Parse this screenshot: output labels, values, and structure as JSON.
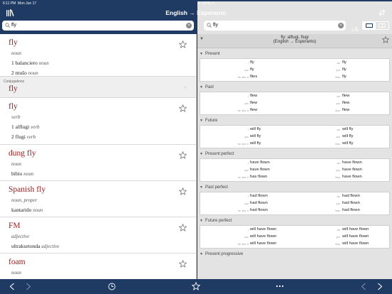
{
  "status": {
    "time": "6:11 PM",
    "date": "Mon Jun 17",
    "battery": "100%"
  },
  "nav": {
    "title": "English → Esperanto"
  },
  "search_left": {
    "value": "fly"
  },
  "search_right": {
    "value": "fly"
  },
  "font_button": {
    "small": "A",
    "large": "A"
  },
  "entries": [
    {
      "headword": "fly",
      "pos": "noun",
      "translations": [
        {
          "num": "1",
          "word": "balanciero",
          "pos": "noun"
        },
        {
          "num": "2",
          "word": "muŝo",
          "pos": "noun"
        }
      ]
    },
    {
      "conj_label": "Conjugations",
      "headword": "fly"
    },
    {
      "headword": "fly",
      "pos": "verb",
      "translations": [
        {
          "num": "1",
          "word": "alflugi",
          "pos": "verb"
        },
        {
          "num": "2",
          "word": "flugi",
          "pos": "verb"
        }
      ]
    },
    {
      "headword": "dung fly",
      "pos": "noun",
      "translations": [
        {
          "word": "bibio",
          "pos": "noun"
        }
      ]
    },
    {
      "headword": "Spanish fly",
      "pos": "noun, proper",
      "translations": [
        {
          "word": "kantarido",
          "pos": "noun"
        }
      ]
    },
    {
      "headword": "FM",
      "pos": "adjective",
      "translations": [
        {
          "word": "ultrakurtonda",
          "pos": "adjective"
        }
      ]
    },
    {
      "headword": "foam",
      "pos": "noun"
    }
  ],
  "detail": {
    "header_line1": "fly: alflugi, flugi",
    "header_line2": "(English → Esperanto)",
    "pronouns": {
      "i": "I",
      "you": "you",
      "he": "he, she, it",
      "we": "we",
      "you_pl": "you",
      "they": "they"
    },
    "sections": [
      {
        "title": "Present",
        "rows": [
          [
            "fly",
            "fly"
          ],
          [
            "fly",
            "fly"
          ],
          [
            "flies",
            "fly"
          ]
        ]
      },
      {
        "title": "Past",
        "rows": [
          [
            "flew",
            "flew"
          ],
          [
            "flew",
            "flew"
          ],
          [
            "flew",
            "flew"
          ]
        ]
      },
      {
        "title": "Future",
        "rows": [
          [
            "will fly",
            "will fly"
          ],
          [
            "will fly",
            "will fly"
          ],
          [
            "will fly",
            "will fly"
          ]
        ]
      },
      {
        "title": "Present perfect",
        "rows": [
          [
            "have flown",
            "have flown"
          ],
          [
            "have flown",
            "have flown"
          ],
          [
            "has flown",
            "have flown"
          ]
        ]
      },
      {
        "title": "Past perfect",
        "rows": [
          [
            "had flown",
            "had flown"
          ],
          [
            "had flown",
            "had flown"
          ],
          [
            "had flown",
            "had flown"
          ]
        ]
      },
      {
        "title": "Future perfect",
        "rows": [
          [
            "will have flown",
            "will have flown"
          ],
          [
            "will have flown",
            "will have flown"
          ],
          [
            "will have flown",
            "will have flown"
          ]
        ]
      },
      {
        "title": "Present progressive"
      }
    ]
  },
  "colors": {
    "bar": "#1f3a63",
    "headword": "#9b1b1b"
  },
  "icons": [
    "library-icon",
    "swap-icon",
    "search-icon",
    "clear-icon",
    "star-icon",
    "chevron-left-icon",
    "chevron-right-icon",
    "history-icon",
    "more-icon"
  ]
}
